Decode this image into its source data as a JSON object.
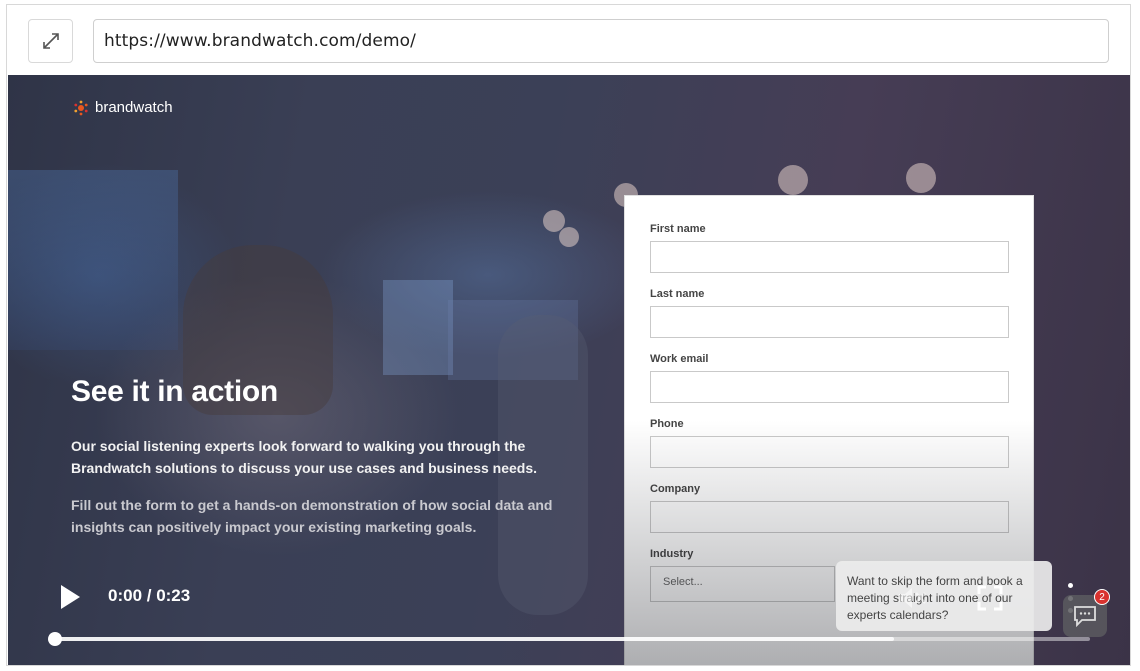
{
  "browser": {
    "url": "https://www.brandwatch.com/demo/",
    "expand_icon": "expand-arrows-icon"
  },
  "brand": {
    "name": "brandwatch",
    "logo_color": "#e8571f"
  },
  "hero": {
    "headline": "See it in action",
    "paragraph1": "Our social listening experts look forward to walking you through the Brandwatch solutions to discuss your use cases and business needs.",
    "paragraph2": "Fill out the form to get a hands-on demonstration of how social data and insights can positively impact your existing marketing goals."
  },
  "form": {
    "fields": [
      {
        "label": "First name",
        "value": ""
      },
      {
        "label": "Last name",
        "value": ""
      },
      {
        "label": "Work email",
        "value": ""
      },
      {
        "label": "Phone",
        "value": ""
      },
      {
        "label": "Company",
        "value": ""
      }
    ],
    "industry": {
      "label": "Industry",
      "selected": "Select..."
    }
  },
  "chat": {
    "prompt": "Want to skip the form and book a meeting straight into one of our experts calendars?",
    "badge_count": "2",
    "icon": "chat-icon"
  },
  "player": {
    "time": "0:00 / 0:23",
    "played_fraction": 0.0,
    "buffered_fraction": 0.81,
    "icons": [
      "play-icon",
      "mute-icon",
      "fullscreen-icon",
      "more-vertical-icon"
    ]
  }
}
